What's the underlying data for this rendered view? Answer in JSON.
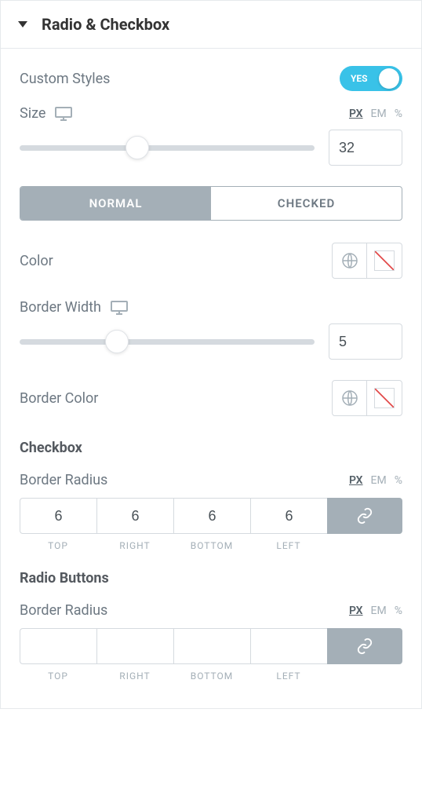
{
  "header": {
    "title": "Radio & Checkbox"
  },
  "customStyles": {
    "label": "Custom Styles",
    "value": "YES"
  },
  "size": {
    "label": "Size",
    "units": [
      "PX",
      "EM",
      "%"
    ],
    "activeUnit": "PX",
    "value": "32",
    "thumbPercent": 40
  },
  "tabs": {
    "normal": "NORMAL",
    "checked": "CHECKED",
    "active": "normal"
  },
  "color": {
    "label": "Color"
  },
  "borderWidth": {
    "label": "Border Width",
    "value": "5",
    "thumbPercent": 33
  },
  "borderColor": {
    "label": "Border Color"
  },
  "checkbox": {
    "heading": "Checkbox",
    "borderRadius": {
      "label": "Border Radius",
      "units": [
        "PX",
        "EM",
        "%"
      ],
      "activeUnit": "PX",
      "top": "6",
      "right": "6",
      "bottom": "6",
      "left": "6",
      "labels": {
        "top": "TOP",
        "right": "RIGHT",
        "bottom": "BOTTOM",
        "left": "LEFT"
      }
    }
  },
  "radio": {
    "heading": "Radio Buttons",
    "borderRadius": {
      "label": "Border Radius",
      "units": [
        "PX",
        "EM",
        "%"
      ],
      "activeUnit": "PX",
      "top": "",
      "right": "",
      "bottom": "",
      "left": "",
      "labels": {
        "top": "TOP",
        "right": "RIGHT",
        "bottom": "BOTTOM",
        "left": "LEFT"
      }
    }
  }
}
